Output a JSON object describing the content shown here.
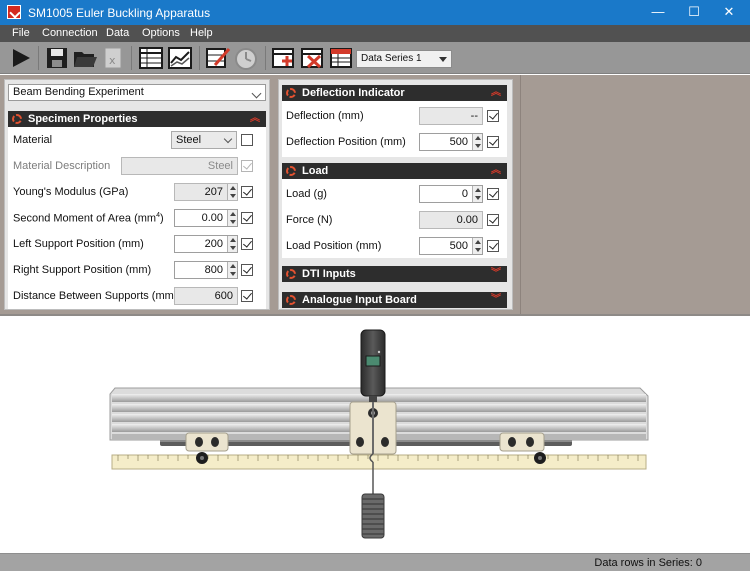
{
  "window": {
    "title": "SM1005 Euler Buckling Apparatus",
    "minimize": "—",
    "maximize": "☐",
    "close": "✕"
  },
  "menu": [
    "File",
    "Connection",
    "Data",
    "Options",
    "Help"
  ],
  "toolbar": {
    "data_series": "Data Series 1",
    "icons": [
      "play-icon",
      "save-icon",
      "open-folder-icon",
      "export-excel-icon",
      "table-icon",
      "chart-icon",
      "edit-chart-icon",
      "timer-icon",
      "add-row-icon",
      "delete-row-icon",
      "data-table-icon"
    ]
  },
  "experiment": {
    "selected": "Beam Bending Experiment"
  },
  "specimen": {
    "header": "Specimen Properties",
    "material_label": "Material",
    "material_value": "Steel",
    "material_desc_label": "Material Description",
    "material_desc_value": "Steel",
    "youngs_label": "Young's Modulus  (GPa)",
    "youngs_value": "207",
    "moment_label": "Second Moment of Area  (mm",
    "moment_sup": "4",
    "moment_close": ")",
    "moment_value": "0.00",
    "left_support_label": "Left Support Position  (mm)",
    "left_support_value": "200",
    "right_support_label": "Right Support Position  (mm)",
    "right_support_value": "800",
    "distance_label": "Distance Between Supports  (mm)",
    "distance_value": "600"
  },
  "deflection": {
    "header": "Deflection Indicator",
    "deflection_label": "Deflection  (mm)",
    "deflection_value": "--",
    "position_label": "Deflection Position  (mm)",
    "position_value": "500"
  },
  "load": {
    "header": "Load",
    "load_label": "Load  (g)",
    "load_value": "0",
    "force_label": "Force  (N)",
    "force_value": "0.00",
    "position_label": "Load Position  (mm)",
    "position_value": "500"
  },
  "dti": {
    "header": "DTI Inputs"
  },
  "analogue": {
    "header": "Analogue Input Board"
  },
  "status": {
    "text": "Data rows in Series: 0"
  },
  "colors": {
    "titlebar": "#1a79c9",
    "menubar": "#515151",
    "toolbar": "#979797",
    "panel_header": "#2d2d2d",
    "accent": "#d33a2a",
    "main_bg": "#a59b94"
  }
}
